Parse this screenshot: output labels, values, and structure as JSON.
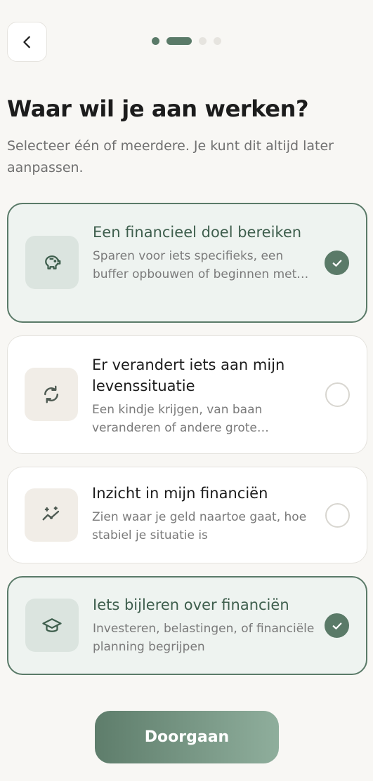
{
  "header": {
    "back_icon": "chevron-left-icon",
    "progress": {
      "total_steps": 4,
      "current_step": 2
    }
  },
  "title": "Waar wil je aan werken?",
  "subtitle": "Selecteer één of meerdere. Je kunt dit altijd later aanpassen.",
  "options": [
    {
      "icon": "piggy-bank-icon",
      "title": "Een financieel doel bereiken",
      "description": "Sparen voor iets specifieks, een buffer opbouwen of beginnen met beleggen",
      "selected": true
    },
    {
      "icon": "refresh-icon",
      "title": "Er verandert iets aan mijn levenssituatie",
      "description": "Een kindje krijgen, van baan veranderen of andere grote beslissingen",
      "selected": false
    },
    {
      "icon": "sparkle-chart-icon",
      "title": "Inzicht in mijn financiën",
      "description": "Zien waar je geld naartoe gaat, hoe stabiel je situatie is",
      "selected": false
    },
    {
      "icon": "graduation-cap-icon",
      "title": "Iets bijleren over financiën",
      "description": "Investeren, belastingen, of financiële planning begrijpen",
      "selected": true
    }
  ],
  "cta": {
    "label": "Doorgaan"
  },
  "colors": {
    "accent": "#5a7a68",
    "background": "#f8f7f4",
    "selected_card": "#eef3f0"
  }
}
